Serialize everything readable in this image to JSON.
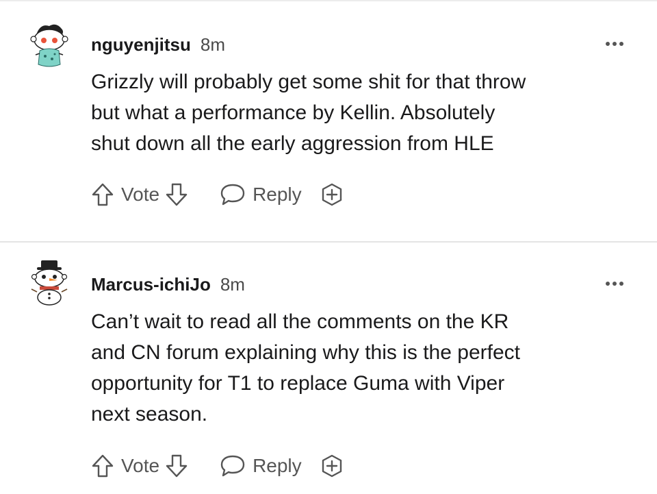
{
  "comments": [
    {
      "username": "nguyenjitsu",
      "timestamp": "8m",
      "body": "Grizzly will probably get some shit for that throw\nbut what a performance by Kellin. Absolutely\nshut down all the early aggression from HLE",
      "vote_label": "Vote",
      "reply_label": "Reply"
    },
    {
      "username": "Marcus-ichiJo",
      "timestamp": "8m",
      "body": "Can’t wait to read all the comments on the KR\nand CN forum explaining why this is the perfect\nopportunity for T1 to replace Guma with Viper\nnext season.",
      "vote_label": "Vote",
      "reply_label": "Reply"
    }
  ],
  "icons": {
    "upvote": "arrow-up-outline-icon",
    "downvote": "arrow-down-outline-icon",
    "reply": "speech-bubble-icon",
    "award": "plus-circle-icon",
    "more": "more-horizontal-icon"
  },
  "colors": {
    "text": "#1a1a1b",
    "meta": "#4a4a4a",
    "icon": "#555555",
    "divider": "#e4e4e4"
  }
}
